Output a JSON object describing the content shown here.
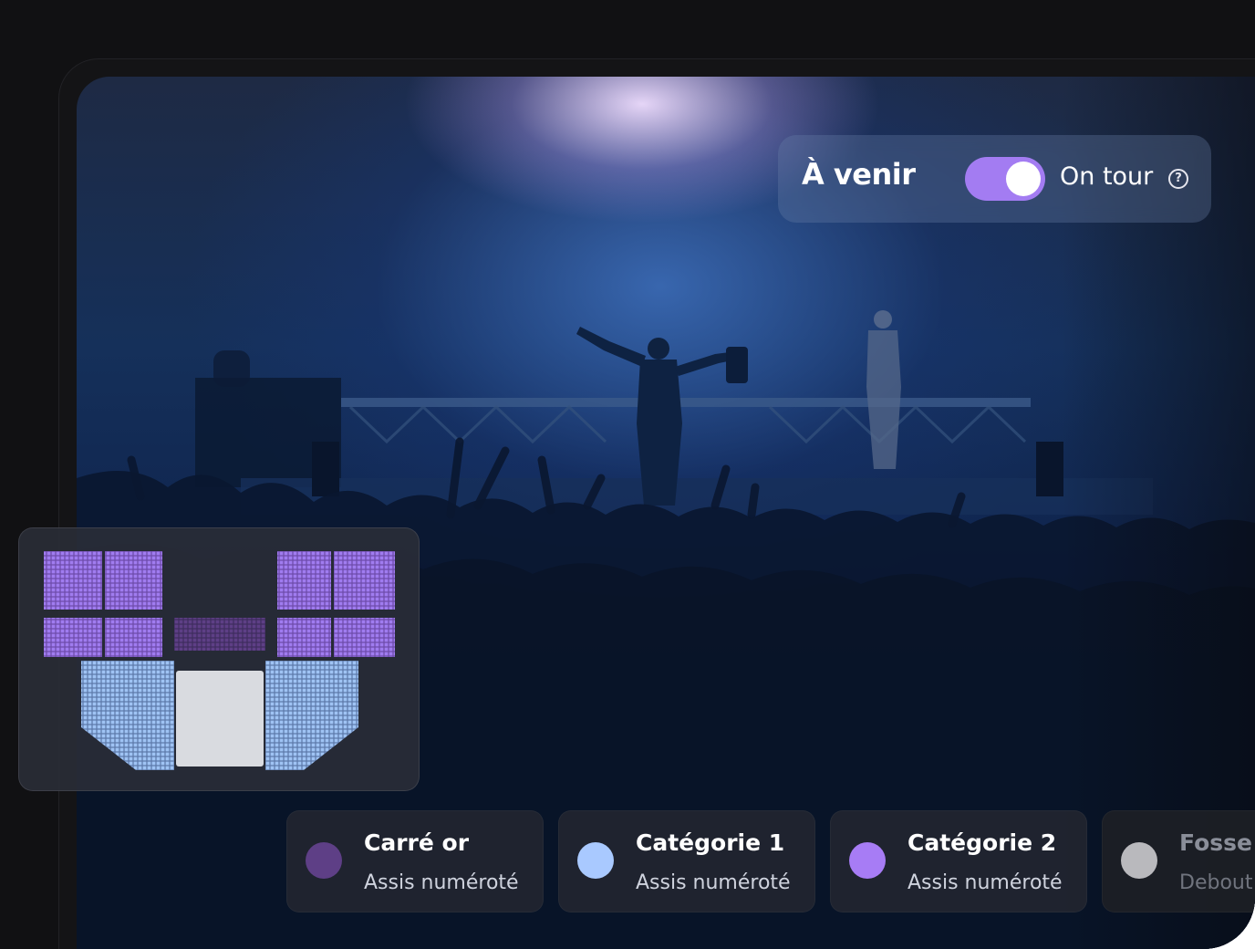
{
  "header": {
    "upcoming_label": "À venir",
    "toggle_state": "on",
    "on_tour_label": "On tour",
    "help_glyph": "?"
  },
  "seat_map": {
    "stage_color": "#d9dbe0",
    "section_colors": {
      "carre_or": "#5e3f86",
      "categorie_1": "#9fc3f4",
      "categorie_2": "#a07cf0"
    }
  },
  "legend": [
    {
      "title": "Carré or",
      "subtitle": "Assis numéroté",
      "color": "#5e3f86"
    },
    {
      "title": "Catégorie 1",
      "subtitle": "Assis numéroté",
      "color": "#a9c9ff"
    },
    {
      "title": "Catégorie 2",
      "subtitle": "Assis numéroté",
      "color": "#a77cf5"
    },
    {
      "title": "Fosse",
      "subtitle": "Debout",
      "color": "#b9b9bd"
    }
  ],
  "colors": {
    "accent": "#a37cf2",
    "background": "#111113"
  }
}
